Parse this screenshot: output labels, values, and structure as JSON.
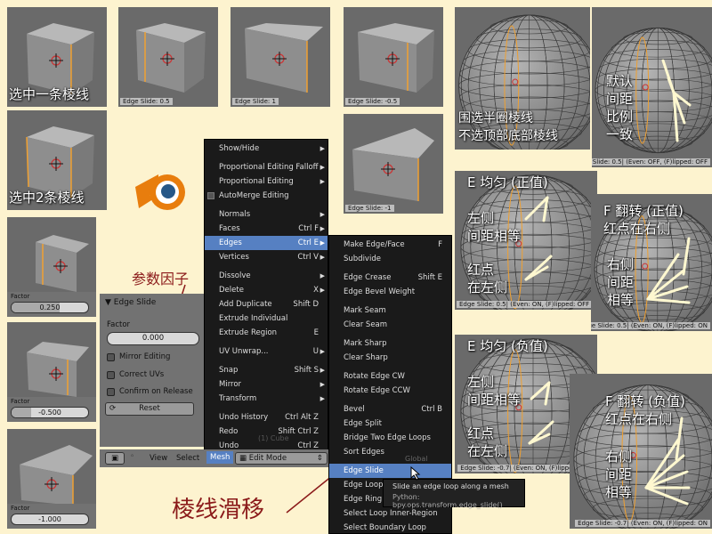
{
  "tiles": {
    "cube1": {
      "caption": "选中一条棱线"
    },
    "cube2": {
      "caption": "选中2条棱线"
    },
    "slide_pos": {
      "label": "Edge Slide: 0.5"
    },
    "slide_one": {
      "label": "Edge Slide: 1"
    },
    "slide_neg": {
      "label": "Edge Slide: -0.5"
    },
    "slide_negone": {
      "label": "Edge Slide: -1"
    },
    "factor1": {
      "label": "Factor",
      "value": "0.250",
      "fill": 0.625
    },
    "factor2": {
      "label": "Factor",
      "value": "-0.500",
      "fill": 0.25
    },
    "factor3": {
      "label": "Factor",
      "value": "-1.000",
      "fill": 0.0
    }
  },
  "annotations": {
    "param_factor": "参数因子",
    "edge_slide_cn": "棱线滑移"
  },
  "spheres": {
    "s1": {
      "caption1": "围选半圈棱线",
      "caption2": "不选顶部底部棱线"
    },
    "s2": {
      "line1": "默认",
      "line2": "间距",
      "line3": "比例",
      "line4": "一致",
      "label": "Edge Slide: 0.5| (Even: OFF, (F)lipped: OFF"
    },
    "s3": {
      "title": "E 均匀 (正值)",
      "left1": "左侧",
      "left2": "间距相等",
      "red1": "红点",
      "red2": "在左侧",
      "label": "Edge Slide: 0.5| (Even: ON, (F)lipped: OFF"
    },
    "s4": {
      "title": "F 翻转 (正值)",
      "sub": "红点在右侧",
      "r1": "右侧",
      "r2": "间距",
      "r3": "相等",
      "label": "Edge Slide: 0.5| (Even: ON, (F)lipped: ON"
    },
    "s5": {
      "title": "E 均匀 (负值)",
      "left1": "左侧",
      "left2": "间距相等",
      "red1": "红点",
      "red2": "在左侧",
      "label": "Edge Slide: -0.7| (Even: ON, (F)lipped: OFF"
    },
    "s6": {
      "title": "F 翻转 (负值)",
      "sub": "红点在右侧",
      "r1": "右侧",
      "r2": "间距",
      "r3": "相等",
      "label": "Edge Slide: -0.7| (Even: ON, (F)lipped: ON"
    }
  },
  "panel": {
    "title": "Edge Slide",
    "factor_label": "Factor",
    "factor_value": "0.000",
    "mirror_editing": "Mirror Editing",
    "correct_uvs": "Correct UVs",
    "confirm_release": "Confirm on Release",
    "reset": "Reset"
  },
  "header": {
    "view": "View",
    "select": "Select",
    "mesh": "Mesh",
    "mode": "Edit Mode",
    "cube_ghost": "(1) Cube",
    "global_ghost": "Global"
  },
  "mesh_menu": [
    {
      "label": "Show/Hide",
      "sc": "",
      "arrow": true
    },
    {
      "sep": true
    },
    {
      "label": "Proportional Editing Falloff",
      "sc": "",
      "arrow": true
    },
    {
      "label": "Proportional Editing",
      "sc": "",
      "arrow": true
    },
    {
      "label": "AutoMerge Editing",
      "sc": "",
      "check": true
    },
    {
      "sep": true
    },
    {
      "label": "Normals",
      "sc": "",
      "arrow": true
    },
    {
      "label": "Faces",
      "sc": "Ctrl F",
      "arrow": true
    },
    {
      "label": "Edges",
      "sc": "Ctrl E",
      "arrow": true,
      "hl": true
    },
    {
      "label": "Vertices",
      "sc": "Ctrl V",
      "arrow": true
    },
    {
      "sep": true
    },
    {
      "label": "Dissolve",
      "sc": "",
      "arrow": true
    },
    {
      "label": "Delete",
      "sc": "X",
      "arrow": true
    },
    {
      "label": "Add Duplicate",
      "sc": "Shift D"
    },
    {
      "label": "Extrude Individual",
      "sc": ""
    },
    {
      "label": "Extrude Region",
      "sc": "E"
    },
    {
      "sep": true
    },
    {
      "label": "UV Unwrap...",
      "sc": "U",
      "arrow": true
    },
    {
      "sep": true
    },
    {
      "label": "Snap",
      "sc": "Shift S",
      "arrow": true
    },
    {
      "label": "Mirror",
      "sc": "",
      "arrow": true
    },
    {
      "label": "Transform",
      "sc": "",
      "arrow": true
    },
    {
      "sep": true
    },
    {
      "label": "Undo History",
      "sc": "Ctrl Alt Z"
    },
    {
      "label": "Redo",
      "sc": "Shift Ctrl Z"
    },
    {
      "label": "Undo",
      "sc": "Ctrl Z"
    }
  ],
  "edges_menu": [
    {
      "label": "Make Edge/Face",
      "sc": "F"
    },
    {
      "label": "Subdivide",
      "sc": ""
    },
    {
      "sep": true
    },
    {
      "label": "Edge Crease",
      "sc": "Shift E"
    },
    {
      "label": "Edge Bevel Weight",
      "sc": ""
    },
    {
      "sep": true
    },
    {
      "label": "Mark Seam",
      "sc": ""
    },
    {
      "label": "Clear Seam",
      "sc": ""
    },
    {
      "sep": true
    },
    {
      "label": "Mark Sharp",
      "sc": ""
    },
    {
      "label": "Clear Sharp",
      "sc": ""
    },
    {
      "sep": true
    },
    {
      "label": "Rotate Edge CW",
      "sc": ""
    },
    {
      "label": "Rotate Edge CCW",
      "sc": ""
    },
    {
      "sep": true
    },
    {
      "label": "Bevel",
      "sc": "Ctrl B"
    },
    {
      "label": "Edge Split",
      "sc": ""
    },
    {
      "label": "Bridge Two Edge Loops",
      "sc": ""
    },
    {
      "label": "Sort Edges",
      "sc": ""
    },
    {
      "sep": true
    },
    {
      "label": "Edge Slide",
      "sc": "",
      "hl": true
    },
    {
      "label": "Edge Loop",
      "sc": ""
    },
    {
      "label": "Edge Ring",
      "sc": ""
    },
    {
      "label": "Select Loop Inner-Region",
      "sc": ""
    },
    {
      "label": "Select Boundary Loop",
      "sc": ""
    }
  ],
  "tooltip": {
    "line1": "Slide an edge loop along a mesh",
    "line2": "Python: bpy.ops.transform.edge_slide()"
  },
  "colors": {
    "accent": "#5680c2",
    "annotation": "#8b1a1a",
    "viewport": "#6a6a6a",
    "background": "#fdf3cf"
  }
}
